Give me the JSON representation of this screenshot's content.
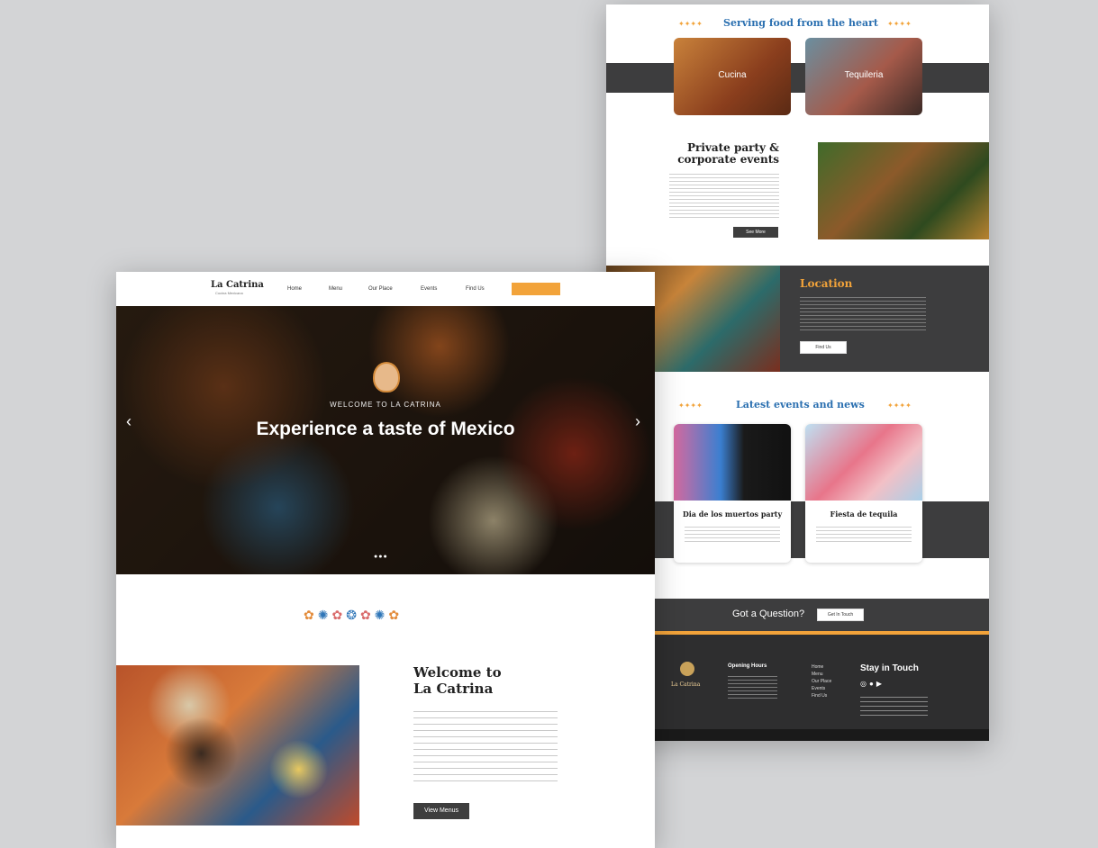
{
  "back_page": {
    "serving": {
      "heading": "Serving food from the heart",
      "cards": [
        {
          "label": "Cucina"
        },
        {
          "label": "Tequileria"
        }
      ]
    },
    "private_party": {
      "heading_line1": "Private party &",
      "heading_line2": "corporate events",
      "button": "See More"
    },
    "location": {
      "heading": "Location",
      "button": "Find Us"
    },
    "events": {
      "heading": "Latest events and news",
      "items": [
        {
          "title": "Dia de los muertos party"
        },
        {
          "title": "Fiesta de tequila"
        }
      ]
    },
    "question": {
      "text": "Got a Question?",
      "button": "Get In Touch"
    },
    "footer": {
      "logo": "La Catrina",
      "hours_heading": "Opening Hours",
      "nav": [
        "Home",
        "Menu",
        "Our Place",
        "Events",
        "Find Us"
      ],
      "stay_heading": "Stay in Touch"
    }
  },
  "front_page": {
    "header": {
      "logo": "La Catrina",
      "logo_sub": "Cocina Mexicana",
      "nav": [
        "Home",
        "Menu",
        "Our Place",
        "Events",
        "Find Us"
      ]
    },
    "hero": {
      "eyebrow": "WELCOME TO LA CATRINA",
      "title": "Experience a taste of Mexico"
    },
    "welcome": {
      "heading_line1": "Welcome to",
      "heading_line2": "La Catrina",
      "button": "View Menus"
    }
  },
  "colors": {
    "accent_orange": "#f2a33a",
    "heading_blue": "#2a6fb0",
    "dark_gray": "#3d3d3e"
  }
}
